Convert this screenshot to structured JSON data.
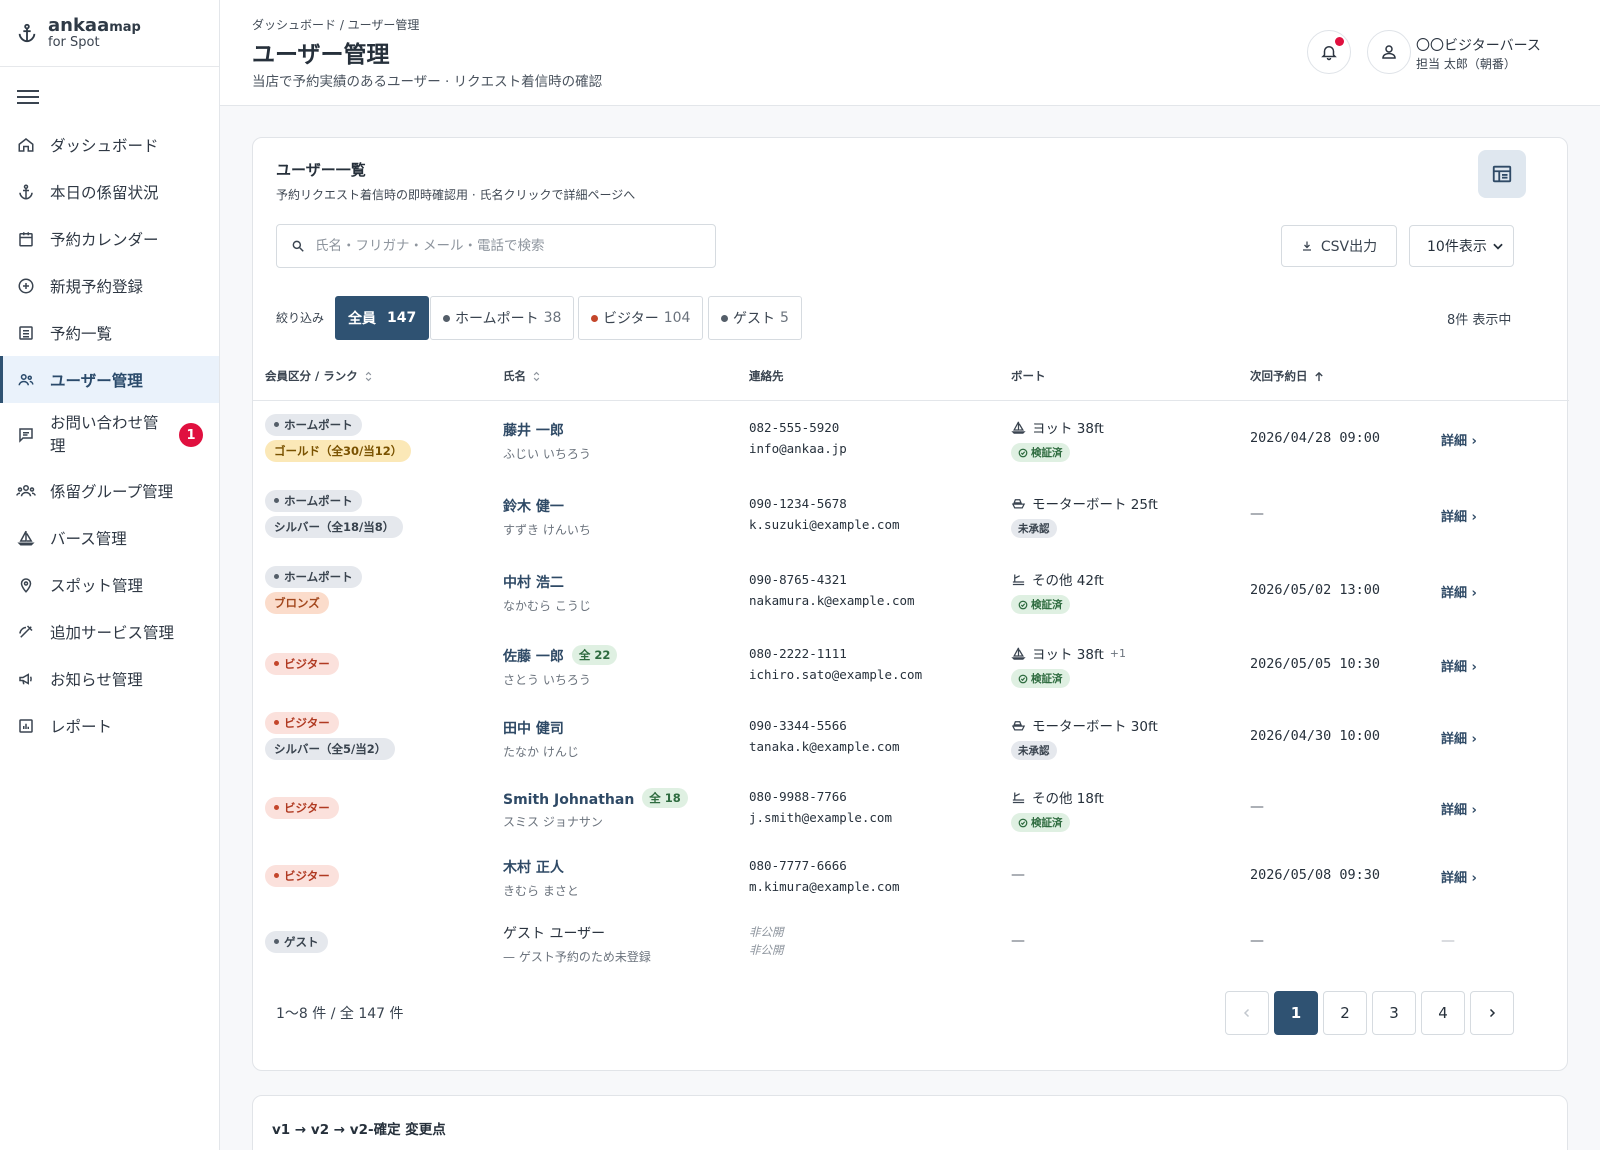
{
  "brand": {
    "name": "ankaa",
    "name_suffix": "map",
    "sub": "for Spot"
  },
  "sidebar": {
    "items": [
      {
        "label": "ダッシュボード",
        "icon": "home-icon"
      },
      {
        "label": "本日の係留状況",
        "icon": "anchor-icon"
      },
      {
        "label": "予約カレンダー",
        "icon": "calendar-icon"
      },
      {
        "label": "新規予約登録",
        "icon": "plus-circle-icon"
      },
      {
        "label": "予約一覧",
        "icon": "list-icon"
      },
      {
        "label": "ユーザー管理",
        "icon": "users-icon",
        "active": true
      },
      {
        "label": "お問い合わせ管理",
        "icon": "chat-icon",
        "badge": "1"
      },
      {
        "label": "係留グループ管理",
        "icon": "group-icon"
      },
      {
        "label": "バース管理",
        "icon": "sailboat-icon"
      },
      {
        "label": "スポット管理",
        "icon": "pin-icon"
      },
      {
        "label": "追加サービス管理",
        "icon": "service-icon"
      },
      {
        "label": "お知らせ管理",
        "icon": "megaphone-icon"
      },
      {
        "label": "レポート",
        "icon": "report-icon"
      }
    ]
  },
  "header": {
    "breadcrumb": "ダッシュボード / ユーザー管理",
    "title": "ユーザー管理",
    "subtitle": "当店で予約実績のあるユーザー · リクエスト着信時の確認",
    "org_name": "〇〇ビジターバース",
    "user_name": "担当 太郎（朝番）"
  },
  "card": {
    "title": "ユーザー一覧",
    "subtitle": "予約リクエスト着信時の即時確認用 · 氏名クリックで詳細ページへ",
    "search_placeholder": "氏名・フリガナ・メール・電話で検索",
    "csv_label": "CSV出力",
    "per_page": "10件表示",
    "filter_label": "絞り込み",
    "filters": [
      {
        "label": "全員",
        "count": "147"
      },
      {
        "label": "ホームポート",
        "count": "38",
        "color": "#545e69"
      },
      {
        "label": "ビジター",
        "count": "104",
        "color": "#c4462b"
      },
      {
        "label": "ゲスト",
        "count": "5",
        "color": "#545e69"
      }
    ],
    "showing": "8件 表示中",
    "columns": {
      "type": "会員区分 / ランク",
      "name": "氏名",
      "contact": "連絡先",
      "boat": "ボート",
      "next": "次回予約日"
    },
    "rows": [
      {
        "type": "ホームポート",
        "rank": "ゴールド（全30/当12）",
        "name": "藤井 一郎",
        "kana": "ふじい いちろう",
        "phone": "082-555-5920",
        "email": "info@ankaa.jp",
        "boat": "ヨット 38ft",
        "verify": "検証済",
        "next": "2026/04/28 09:00",
        "detail": "詳細 ›"
      },
      {
        "type": "ホームポート",
        "rank": "シルバー（全18/当8）",
        "name": "鈴木 健一",
        "kana": "すずき けんいち",
        "phone": "090-1234-5678",
        "email": "k.suzuki@example.com",
        "boat": "モーターボート 25ft",
        "verify": "未承認",
        "next": "—",
        "detail": "詳細 ›"
      },
      {
        "type": "ホームポート",
        "rank": "ブロンズ",
        "name": "中村 浩二",
        "kana": "なかむら こうじ",
        "phone": "090-8765-4321",
        "email": "nakamura.k@example.com",
        "boat": "その他 42ft",
        "verify": "検証済",
        "next": "2026/05/02 13:00",
        "detail": "詳細 ›"
      },
      {
        "type": "ビジター",
        "name": "佐藤 一郎",
        "total": "全 22",
        "kana": "さとう いちろう",
        "phone": "080-2222-1111",
        "email": "ichiro.sato@example.com",
        "boat": "ヨット 38ft",
        "boat_extra": "+1",
        "verify": "検証済",
        "next": "2026/05/05 10:30",
        "detail": "詳細 ›"
      },
      {
        "type": "ビジター",
        "rank": "シルバー（全5/当2）",
        "name": "田中 健司",
        "kana": "たなか けんじ",
        "phone": "090-3344-5566",
        "email": "tanaka.k@example.com",
        "boat": "モーターボート 30ft",
        "verify": "未承認",
        "next": "2026/04/30 10:00",
        "detail": "詳細 ›"
      },
      {
        "type": "ビジター",
        "name": "Smith Johnathan",
        "total": "全 18",
        "kana": "スミス ジョナサン",
        "phone": "080-9988-7766",
        "email": "j.smith@example.com",
        "boat": "その他 18ft",
        "verify": "検証済",
        "next": "—",
        "detail": "詳細 ›"
      },
      {
        "type": "ビジター",
        "name": "木村 正人",
        "kana": "きむら まさと",
        "phone": "080-7777-6666",
        "email": "m.kimura@example.com",
        "boat": "—",
        "next": "2026/05/08 09:30",
        "detail": "詳細 ›"
      },
      {
        "type": "ゲスト",
        "name": "ゲスト ユーザー",
        "kana": "— ゲスト予約のため未登録",
        "phone": "非公開",
        "email": "非公開",
        "boat": "—",
        "next": "—",
        "detail": "—"
      }
    ],
    "range": "1〜8 件 / 全 147 件",
    "pages": [
      "1",
      "2",
      "3",
      "4"
    ]
  },
  "changelog": {
    "title": "v1 → v2 → v2-確定 変更点"
  },
  "colors": {
    "accent": "#2f5272",
    "alert": "#e0103f"
  }
}
